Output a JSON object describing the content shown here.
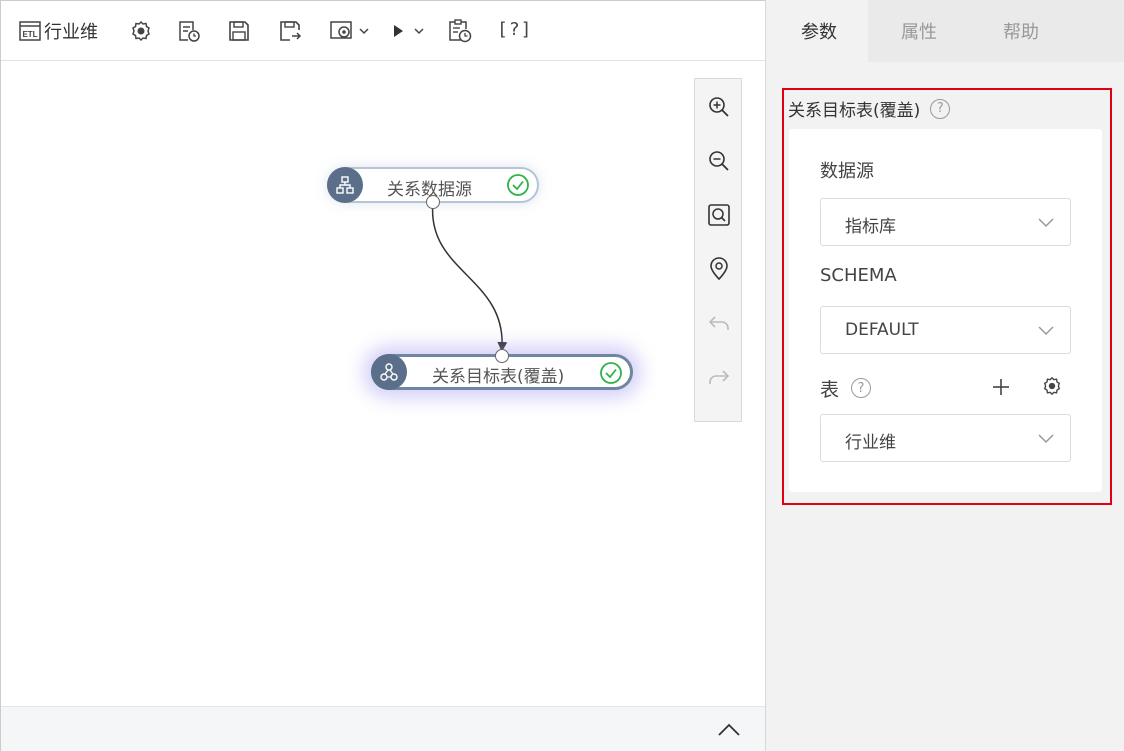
{
  "toolbar": {
    "title": "行业维",
    "help_label": "[?]"
  },
  "canvas": {
    "nodes": [
      {
        "label": "关系数据源",
        "status": "success"
      },
      {
        "label": "关系目标表(覆盖)",
        "status": "success",
        "selected": true
      }
    ]
  },
  "panel": {
    "tabs": [
      {
        "label": "参数",
        "active": true
      },
      {
        "label": "属性",
        "active": false
      },
      {
        "label": "帮助",
        "active": false
      }
    ],
    "section_title": "关系目标表(覆盖)",
    "fields": {
      "datasource_label": "数据源",
      "datasource_value": "指标库",
      "schema_label": "SCHEMA",
      "schema_value": "DEFAULT",
      "table_label": "表",
      "table_value": "行业维"
    }
  },
  "colors": {
    "highlight_border": "#e0000f",
    "node_icon_bg": "#5b6f8a",
    "success_green": "#2db34a",
    "selected_glow": "#a096f0"
  },
  "icons": [
    "etl-icon",
    "settings-icon",
    "run-log-icon",
    "save-icon",
    "save-as-icon",
    "config-dropdown-icon",
    "run-dropdown-icon",
    "schedule-icon",
    "zoom-in-icon",
    "zoom-out-icon",
    "fit-view-icon",
    "locate-icon",
    "undo-icon",
    "redo-icon",
    "collapse-up-icon",
    "expand-panel-icon",
    "help-circle-icon",
    "add-icon",
    "gear-icon",
    "chevron-down-icon",
    "check-circle-icon"
  ]
}
